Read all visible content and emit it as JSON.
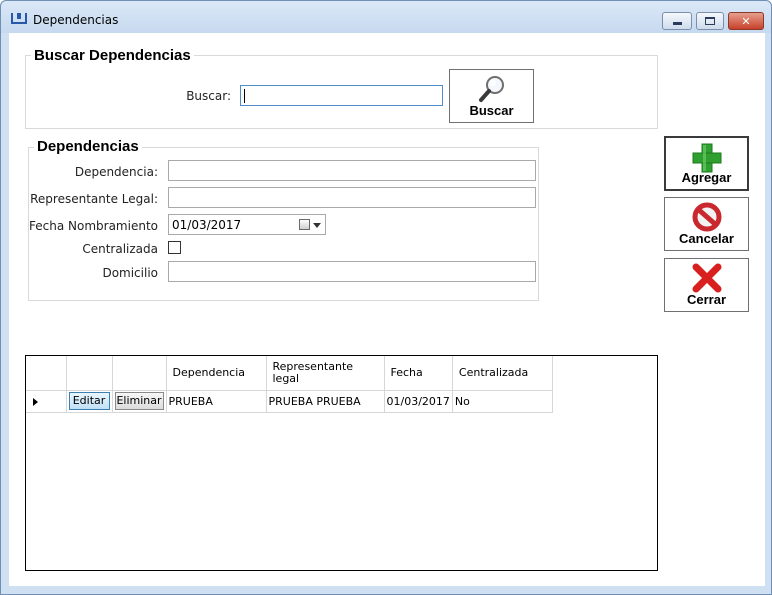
{
  "window": {
    "title": "Dependencias"
  },
  "search": {
    "group_title": "Buscar Dependencias",
    "label": "Buscar:",
    "value": "",
    "button_label": "Buscar"
  },
  "form": {
    "group_title": "Dependencias",
    "dependencia_label": "Dependencia:",
    "dependencia_value": "",
    "representante_label": "Representante Legal:",
    "representante_value": "",
    "fecha_label": "Fecha Nombramiento",
    "fecha_value": "01/03/2017",
    "centralizada_label": "Centralizada",
    "centralizada_checked": false,
    "domicilio_label": "Domicilio",
    "domicilio_value": ""
  },
  "actions": {
    "agregar_label": "Agregar",
    "cancelar_label": "Cancelar",
    "cerrar_label": "Cerrar"
  },
  "grid": {
    "columns": [
      "",
      "",
      "Dependencia",
      "Representante legal",
      "Fecha",
      "Centralizada"
    ],
    "rows": [
      {
        "edit_label": "Editar",
        "delete_label": "Eliminar",
        "dependencia": "PRUEBA",
        "representante": "PRUEBA PRUEBA",
        "fecha": "01/03/2017",
        "centralizada": "No"
      }
    ]
  },
  "colors": {
    "title_bar": "#c6d9ef",
    "close_button": "#c7402a",
    "plus_green": "#2fa02f",
    "cancel_red": "#c8282e",
    "close_red": "#d8201e"
  },
  "icons": [
    "app-icon",
    "magnifier-icon",
    "plus-icon",
    "cancel-icon",
    "x-icon",
    "calendar-icon"
  ]
}
